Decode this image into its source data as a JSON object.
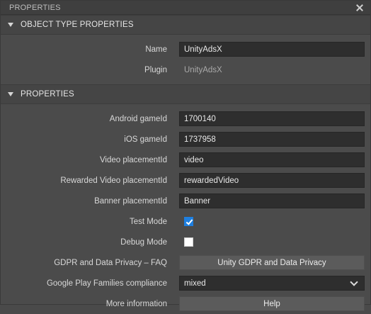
{
  "window": {
    "title": "PROPERTIES"
  },
  "sections": {
    "object_type": {
      "title": "OBJECT TYPE PROPERTIES",
      "name_label": "Name",
      "name_value": "UnityAdsX",
      "plugin_label": "Plugin",
      "plugin_value": "UnityAdsX"
    },
    "properties": {
      "title": "PROPERTIES",
      "android_label": "Android gameId",
      "android_value": "1700140",
      "ios_label": "iOS gameId",
      "ios_value": "1737958",
      "video_label": "Video placementId",
      "video_value": "video",
      "rewarded_label": "Rewarded Video placementId",
      "rewarded_value": "rewardedVideo",
      "banner_label": "Banner placementId",
      "banner_value": "Banner",
      "test_mode_label": "Test Mode",
      "test_mode_checked": true,
      "debug_mode_label": "Debug Mode",
      "debug_mode_checked": false,
      "gdpr_label": "GDPR and Data Privacy – FAQ",
      "gdpr_button": "Unity GDPR and Data Privacy",
      "families_label": "Google Play Families compliance",
      "families_value": "mixed",
      "more_label": "More information",
      "help_button": "Help"
    }
  },
  "colors": {
    "panel_bg": "#4b4b4b",
    "input_bg": "#2e2e2e",
    "checkbox_checked": "#1e7fe0",
    "button_bg": "#5b5b5b"
  },
  "icons": [
    "close-icon",
    "collapse-triangle-icon",
    "check-icon",
    "chevron-down-icon"
  ]
}
